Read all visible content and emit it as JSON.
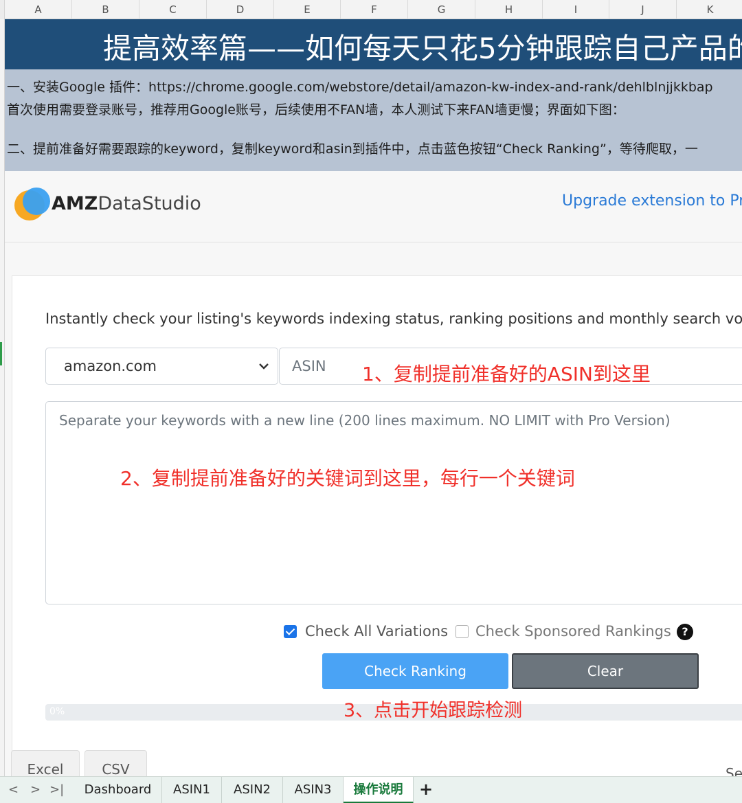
{
  "sheet": {
    "columns": [
      "A",
      "B",
      "C",
      "D",
      "E",
      "F",
      "G",
      "H",
      "I",
      "J",
      "K"
    ],
    "title": "提高效率篇——如何每天只花5分钟跟踪自己产品的",
    "instructions": [
      "一、安装Google 插件：https://chrome.google.com/webstore/detail/amazon-kw-index-and-rank/dehlblnjjkkbap",
      "首次使用需要登录账号，推荐用Google账号，后续使用不FAN墙，本人测试下来FAN墙更慢；界面如下图：",
      "二、提前准备好需要跟踪的keyword，复制keyword和asin到插件中，点击蓝色按钮“Check Ranking”，等待爬取，一"
    ],
    "tabs": [
      "Dashboard",
      "ASIN1",
      "ASIN2",
      "ASIN3",
      "操作说明"
    ],
    "active_tab": "操作说明",
    "add_label": "+",
    "nav": {
      "prev": "<",
      "next": ">",
      "last": ">|"
    }
  },
  "ext": {
    "logo_bold": "AMZ",
    "logo_rest": "DataStudio",
    "upgrade": "Upgrade extension to Pr",
    "description": "Instantly check your listing's keywords indexing status, ranking positions and monthly search vo",
    "marketplace": "amazon.com",
    "asin_placeholder": "ASIN",
    "keywords_placeholder": "Separate your keywords with a new line (200 lines maximum. NO LIMIT with Pro Version)",
    "check_all_variations": "Check All Variations",
    "check_sponsored": "Check Sponsored Rankings",
    "help": "?",
    "check_ranking": "Check Ranking",
    "clear": "Clear",
    "progress_label": "0%",
    "progress": 0,
    "export_tabs": [
      "Excel",
      "CSV"
    ],
    "right_cut": "Se"
  },
  "annotations": {
    "a1": "1、复制提前准备好的ASIN到这里",
    "a2": "2、复制提前准备好的关键词到这里，每行一个关键词",
    "a3": "3、点击开始跟踪检测"
  },
  "colors": {
    "title_bg": "#1f4e79",
    "instr_bg": "#b7c3d3",
    "link_blue": "#2a7ad6",
    "primary_btn": "#4aa3f5",
    "secondary_btn": "#6c757d",
    "annotation_red": "#f0302a",
    "active_tab": "#1a7a3c"
  }
}
